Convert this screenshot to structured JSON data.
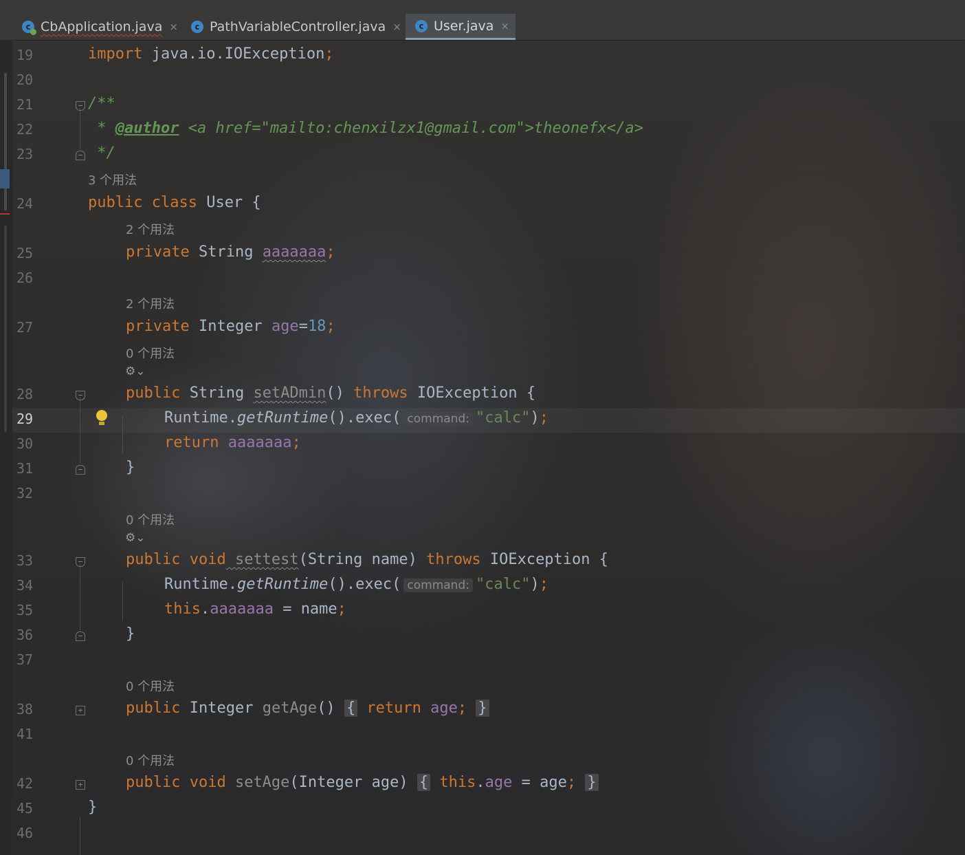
{
  "tabs": [
    {
      "label": "CbApplication.java",
      "icon": "spring-app-icon",
      "active": false,
      "error": true
    },
    {
      "label": "PathVariableController.java",
      "icon": "class-icon",
      "active": false
    },
    {
      "label": "User.java",
      "icon": "class-icon",
      "active": true
    }
  ],
  "tab_close_glyph": "×",
  "class_icon_letter": "c",
  "usages": {
    "u3": "3 个用法",
    "u2a": "2 个用法",
    "u2b": "2 个用法",
    "u0a": "0 个用法",
    "u0b": "0 个用法",
    "u0c": "0 个用法",
    "u0d": "0 个用法"
  },
  "line_numbers": [
    "19",
    "20",
    "21",
    "22",
    "23",
    "24",
    "25",
    "26",
    "27",
    "28",
    "29",
    "30",
    "31",
    "32",
    "33",
    "34",
    "35",
    "36",
    "37",
    "38",
    "41",
    "42",
    "45",
    "46"
  ],
  "current_line": "29",
  "code": {
    "l19_kw": "import",
    "l19_rest": " java.io.IOException",
    "l19_semi": ";",
    "l21": "/**",
    "l22_star": " * ",
    "l22_tag": "@author",
    "l22_rest": " <a href=\"mailto:chenxilzx1@gmail.com\">theonefx</a>",
    "l23": " */",
    "l24_kw": "public class",
    "l24_rest": " User {",
    "l25_kw": "private",
    "l25_type": " String ",
    "l25_field": "aaaaaaa",
    "l25_semi": ";",
    "l27_kw": "private",
    "l27_type": " Integer ",
    "l27_field": "age",
    "l27_eq": "=",
    "l27_num": "18",
    "l27_semi": ";",
    "l28_kw": "public",
    "l28_type": " String ",
    "l28_method": "setADmin",
    "l28_paren": "() ",
    "l28_throws": "throws",
    "l28_rest": " IOException {",
    "l29_a": "Runtime.",
    "l29_m": "getRuntime",
    "l29_b": "().exec(",
    "l29_hint": "command:",
    "l29_str": "\"calc\"",
    "l29_c": ")",
    "l29_semi": ";",
    "l30_kw": "return",
    "l30_field": " aaaaaaa",
    "l30_semi": ";",
    "l31": "}",
    "l33_kw": "public void",
    "l33_method": " settest",
    "l33_rest": "(String name) ",
    "l33_throws": "throws",
    "l33_rest2": " IOException {",
    "l34_a": "Runtime.",
    "l34_m": "getRuntime",
    "l34_b": "().exec(",
    "l34_hint": "command:",
    "l34_str": "\"calc\"",
    "l34_c": ")",
    "l34_semi": ";",
    "l35_kw": "this",
    "l35_dot": ".",
    "l35_field": "aaaaaaa",
    "l35_rest": " = name",
    "l35_semi": ";",
    "l36": "}",
    "l38_kw": "public",
    "l38_type": " Integer ",
    "l38_method": "getAge",
    "l38_paren": "() ",
    "l38_ob": "{",
    "l38_ret": " return",
    "l38_field": " age",
    "l38_semi": ";",
    "l38_cb": "}",
    "l42_kw": "public void",
    "l42_method": " setAge",
    "l42_rest": "(Integer age) ",
    "l42_ob": "{",
    "l42_this": " this",
    "l42_dot": ".",
    "l42_field": "age",
    "l42_rest2": " = age",
    "l42_semi": ";",
    "l42_cb": "}",
    "l45": "}"
  },
  "colors": {
    "keyword": "#cc7832",
    "comment": "#629755",
    "string": "#6a8759",
    "field": "#9876aa",
    "number": "#6897bb",
    "text": "#a9b7c6"
  }
}
